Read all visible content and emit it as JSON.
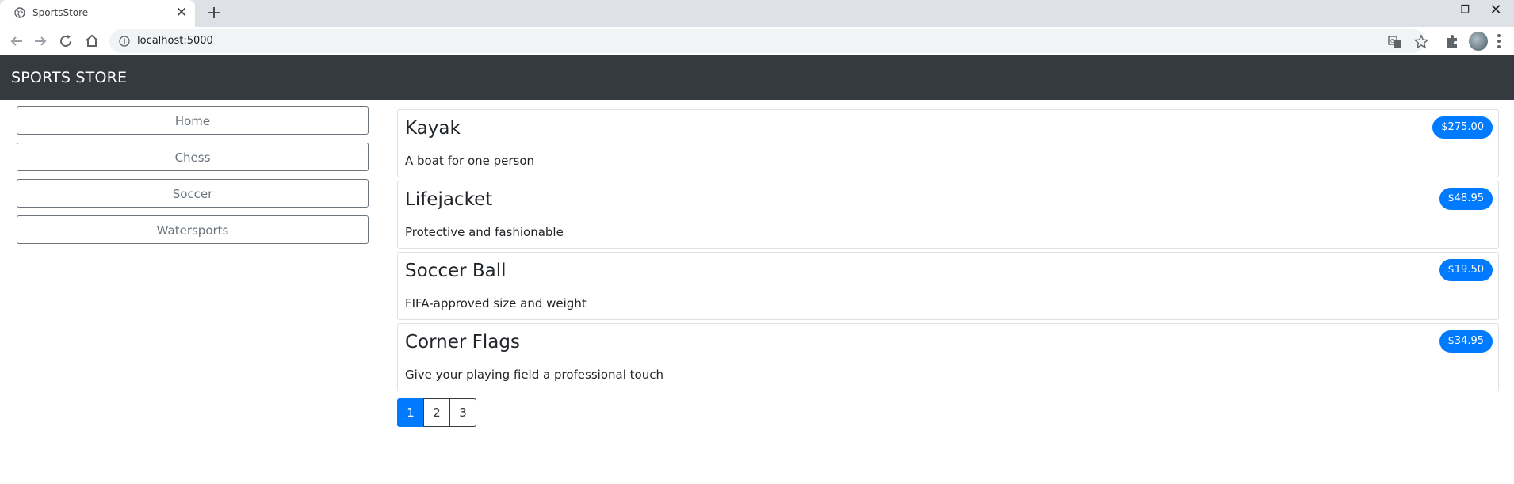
{
  "browser": {
    "tab_title": "SportsStore",
    "url": "localhost:5000"
  },
  "navbar": {
    "brand": "SPORTS STORE"
  },
  "categories": [
    {
      "label": "Home"
    },
    {
      "label": "Chess"
    },
    {
      "label": "Soccer"
    },
    {
      "label": "Watersports"
    }
  ],
  "products": [
    {
      "name": "Kayak",
      "price": "$275.00",
      "description": "A boat for one person"
    },
    {
      "name": "Lifejacket",
      "price": "$48.95",
      "description": "Protective and fashionable"
    },
    {
      "name": "Soccer Ball",
      "price": "$19.50",
      "description": "FIFA-approved size and weight"
    },
    {
      "name": "Corner Flags",
      "price": "$34.95",
      "description": "Give your playing field a professional touch"
    }
  ],
  "pagination": {
    "pages": [
      "1",
      "2",
      "3"
    ],
    "current": "1"
  },
  "colors": {
    "navbar_bg": "#343a40",
    "primary": "#007bff",
    "outline": "#6c757d"
  }
}
